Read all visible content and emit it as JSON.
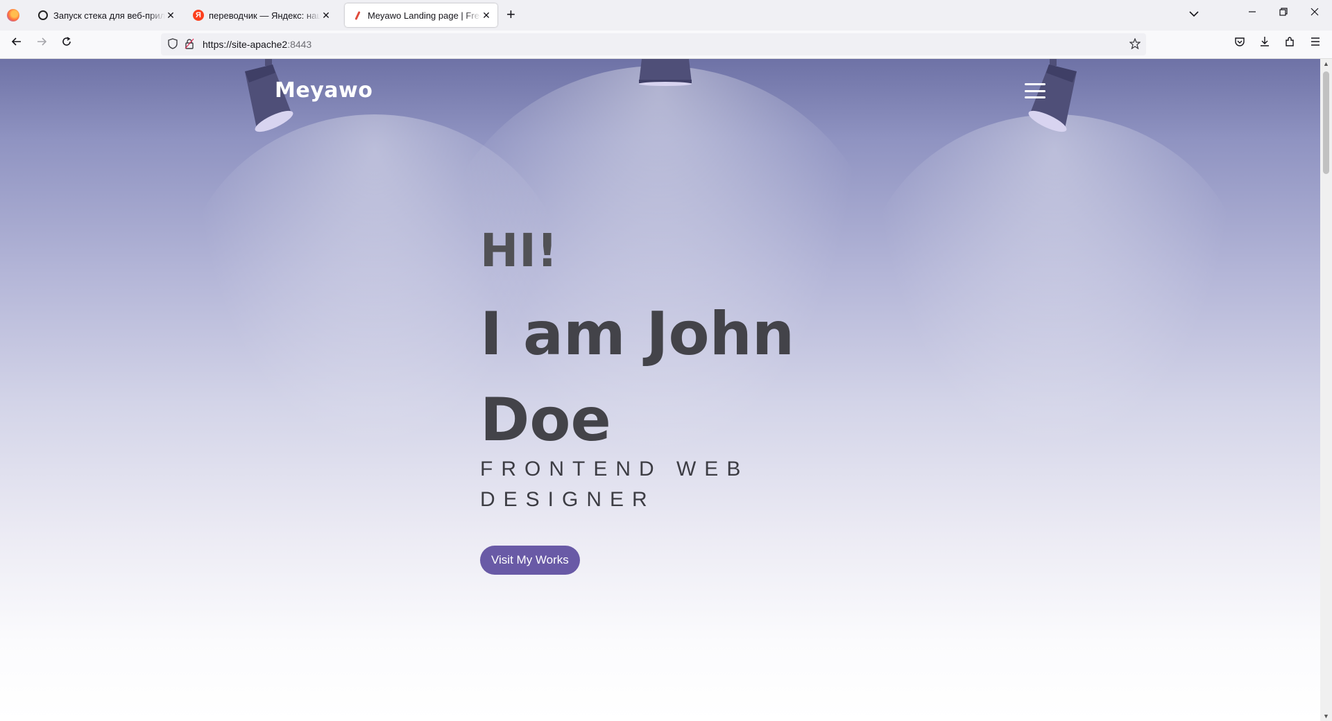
{
  "browser": {
    "tabs": [
      {
        "title": "Запуск стека для веб-приложения",
        "icon": "openai-icon",
        "active": false
      },
      {
        "title": "переводчик — Яндекс: нашлось",
        "icon": "yandex-icon",
        "icon_letter": "Я",
        "active": false
      },
      {
        "title": "Meyawo Landing page | Free Bootstrap",
        "icon": "feather-icon",
        "active": true
      }
    ],
    "new_tab_glyph": "+",
    "close_glyph": "✕",
    "url": {
      "scheme_host": "https://site-apache2",
      "port": ":8443"
    }
  },
  "page": {
    "brand": "Meyawo",
    "greeting": "HI!",
    "name": "I am John Doe",
    "role": "FRONTEND WEB DESIGNER",
    "cta_label": "Visit My Works"
  },
  "colors": {
    "accent": "#695aa6",
    "heading": "#434349",
    "hero_top": "#6e72a6",
    "lamp": "#4f4f78"
  }
}
